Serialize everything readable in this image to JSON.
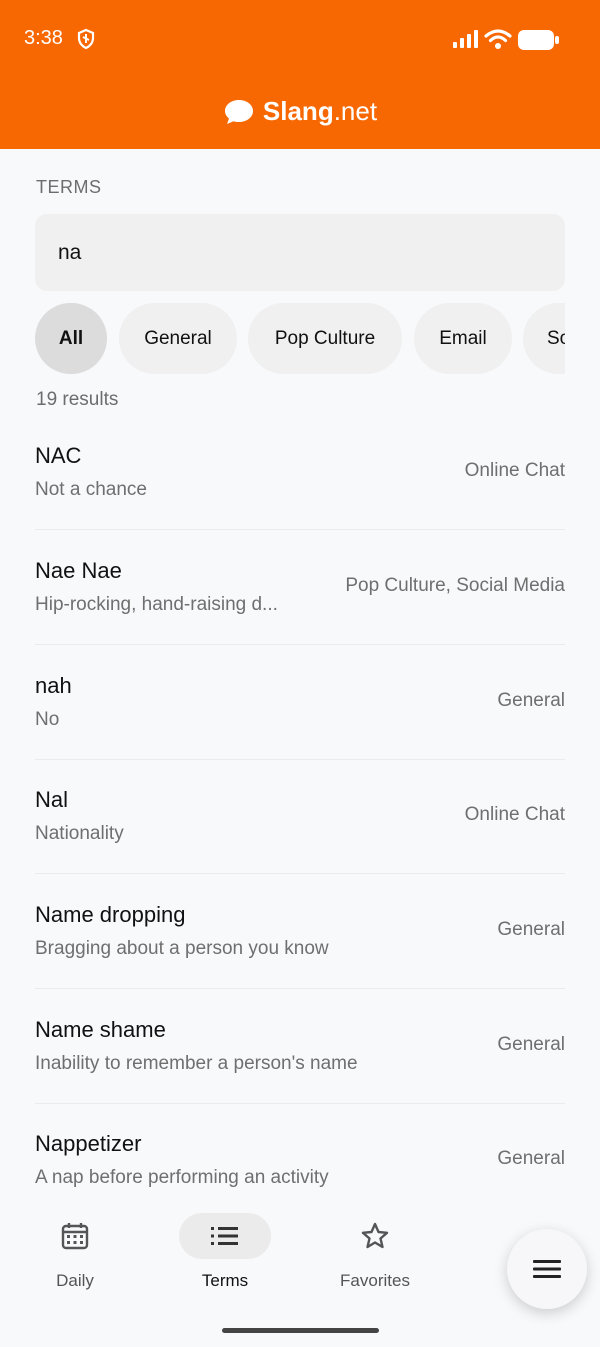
{
  "status": {
    "time": "3:38"
  },
  "brand": {
    "name_bold": "Slang",
    "name_light": ".net"
  },
  "section": {
    "label": "TERMS"
  },
  "search": {
    "value": "na"
  },
  "chips": [
    "All",
    "General",
    "Pop Culture",
    "Email",
    "Social Media"
  ],
  "results": {
    "label": "19 results"
  },
  "terms": [
    {
      "term": "NAC",
      "definition": "Not a chance",
      "category": "Online Chat"
    },
    {
      "term": "Nae Nae",
      "definition": "Hip-rocking, hand-raising d...",
      "category": "Pop Culture, Social Media"
    },
    {
      "term": "nah",
      "definition": "No",
      "category": "General"
    },
    {
      "term": "Nal",
      "definition": "Nationality",
      "category": "Online Chat"
    },
    {
      "term": "Name dropping",
      "definition": "Bragging about a person you know",
      "category": "General"
    },
    {
      "term": "Name shame",
      "definition": "Inability to remember a person's name",
      "category": "General"
    },
    {
      "term": "Nappetizer",
      "definition": "A nap before performing an activity",
      "category": "General"
    }
  ],
  "nav": {
    "daily": "Daily",
    "terms": "Terms",
    "favorites": "Favorites"
  },
  "colors": {
    "brand": "#f76803"
  }
}
